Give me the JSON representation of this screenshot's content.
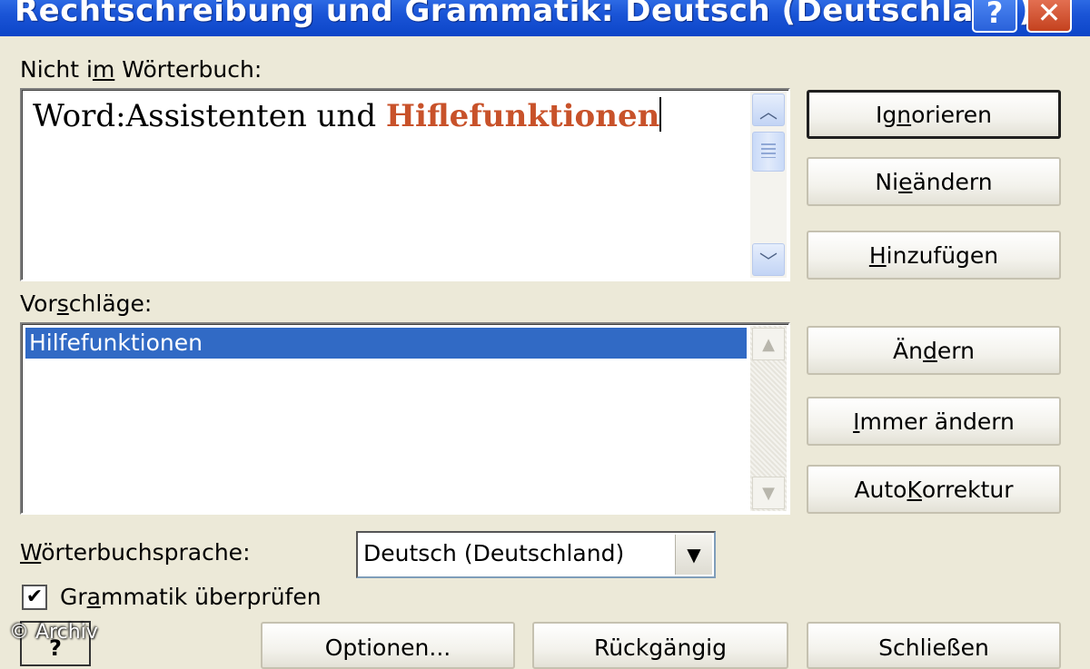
{
  "window": {
    "title": "Rechtschreibung und Grammatik: Deutsch (Deutschland)",
    "help_glyph": "?",
    "close_glyph": "✕"
  },
  "not_in_dictionary": {
    "label_pre": "Nicht i",
    "label_key": "m",
    "label_post": " Wörterbuch:",
    "text_before": "Word:Assistenten und ",
    "text_error": "Hiflefunktionen",
    "error_color": "#c8522a"
  },
  "suggestions": {
    "label_pre": "Vor",
    "label_key": "s",
    "label_post": "chläge:",
    "items": [
      "Hilfefunktionen"
    ]
  },
  "buttons": {
    "ignore": {
      "pre": "Ig",
      "key": "n",
      "post": "orieren"
    },
    "never_change": {
      "pre": "Ni",
      "key": "e",
      "post": " ändern"
    },
    "add": {
      "pre": "",
      "key": "H",
      "post": "inzufügen"
    },
    "change": {
      "pre": "Än",
      "key": "d",
      "post": "ern"
    },
    "change_all": {
      "pre": "",
      "key": "I",
      "post": "mmer ändern"
    },
    "autocorrect": {
      "pre": "Auto",
      "key": "K",
      "post": "orrektur"
    },
    "options": "Optionen...",
    "undo": "Rückgängig",
    "close": "Schließen"
  },
  "dictionary_language": {
    "label_pre": "",
    "label_key": "W",
    "label_post": "örterbuchsprache:",
    "value": "Deutsch (Deutschland)"
  },
  "check_grammar": {
    "label_pre": "Gr",
    "label_key": "a",
    "label_post": "mmatik überprüfen",
    "checked": true,
    "check_glyph": "✔"
  },
  "watermark": "© Archiv",
  "colors": {
    "titlebar": "#0c45c8",
    "selection": "#316ac5",
    "dialog_bg": "#ece9d8"
  }
}
